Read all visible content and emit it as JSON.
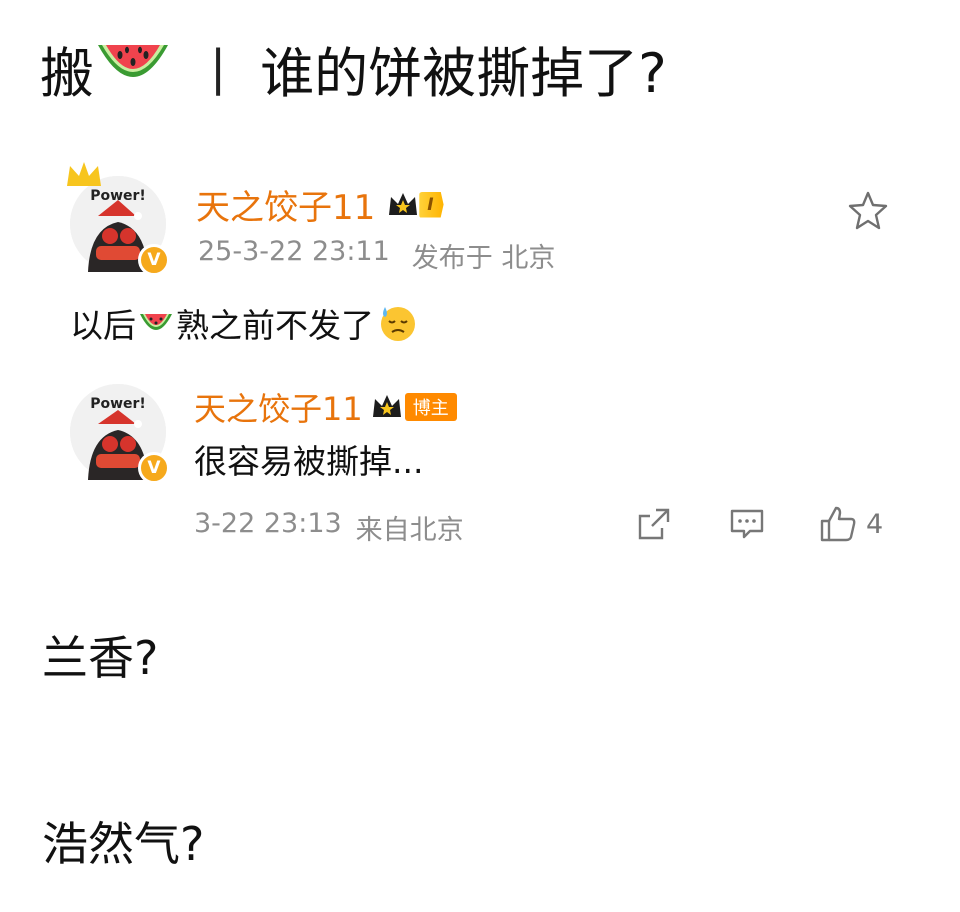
{
  "header": {
    "prefix": "搬",
    "separator": "|",
    "title": "谁的饼被撕掉了?"
  },
  "comment": {
    "avatar_text": "Power!",
    "username": "天之饺子11",
    "rank_label": "I",
    "date": "25-3-22 23:11",
    "location": "发布于 北京",
    "text_before": "以后",
    "text_after": "熟之前不发了",
    "reply": {
      "avatar_text": "Power!",
      "username": "天之饺子11",
      "badge": "博主",
      "text": "很容易被撕掉...",
      "date": "3-22 23:13",
      "location": "来自北京",
      "like_count": "4"
    }
  },
  "sections": [
    {
      "text": "兰香?"
    },
    {
      "text": "浩然气?"
    }
  ],
  "colors": {
    "username": "#e8740c",
    "meta": "#8d8d8d",
    "verified": "#f6a91c",
    "blogger_badge": "#ff8a00"
  },
  "icons": {
    "watermelon": "watermelon-icon",
    "star": "star-icon",
    "crown": "crown-icon",
    "sweat": "sweat-emoji-icon",
    "share": "share-icon",
    "comment": "comment-icon",
    "like": "thumbs-up-icon"
  }
}
